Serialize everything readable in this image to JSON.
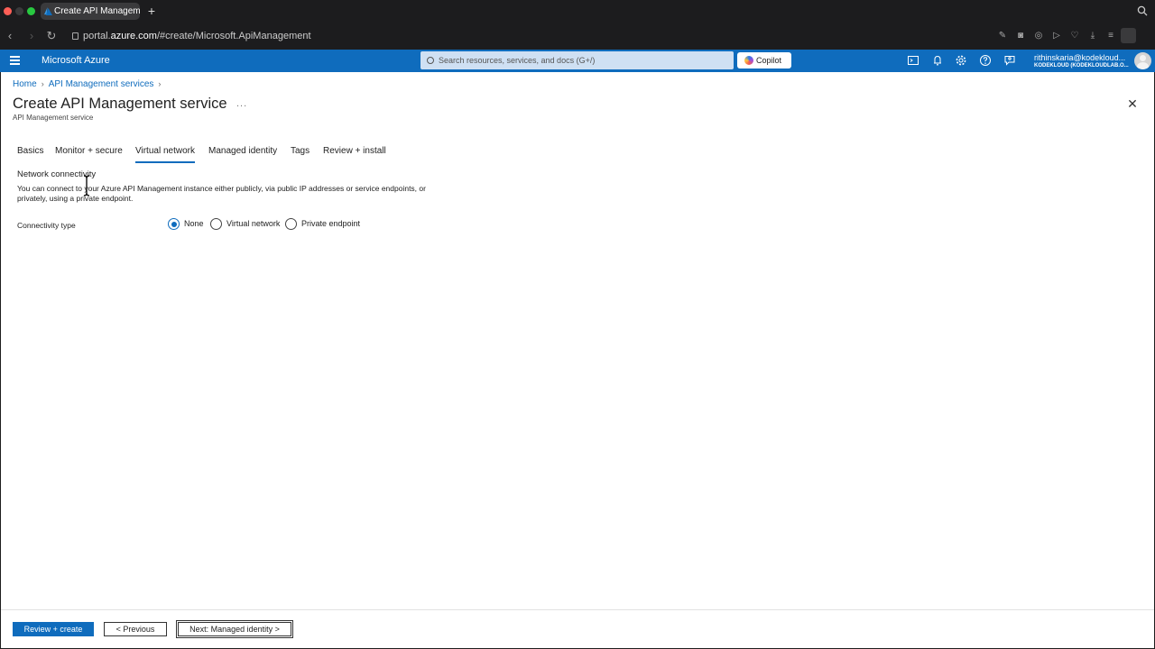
{
  "browser": {
    "tab_title": "Create API Management",
    "url_prefix": "portal.",
    "url_domain": "azure.com",
    "url_path": "/#create/Microsoft.ApiManagement"
  },
  "header": {
    "brand": "Microsoft Azure",
    "search_placeholder": "Search resources, services, and docs (G+/)",
    "copilot_label": "Copilot",
    "account_name": "rithinskaria@kodekloud...",
    "account_org": "KODEKLOUD (KODEKLOUDLAB.O..."
  },
  "breadcrumb": {
    "home": "Home",
    "parent": "API Management services"
  },
  "page": {
    "title": "Create API Management service",
    "more": "...",
    "subtitle": "API Management service"
  },
  "tabs": [
    {
      "label": "Basics"
    },
    {
      "label": "Monitor + secure"
    },
    {
      "label": "Virtual network"
    },
    {
      "label": "Managed identity"
    },
    {
      "label": "Tags"
    },
    {
      "label": "Review + install"
    }
  ],
  "active_tab": "Virtual network",
  "section": {
    "title": "Network connectivity",
    "description": "You can connect to your Azure API Management instance either publicly, via public IP addresses or service endpoints, or privately, using a private endpoint.",
    "connectivity_label": "Connectivity type",
    "options": [
      {
        "label": "None",
        "checked": true
      },
      {
        "label": "Virtual network",
        "checked": false
      },
      {
        "label": "Private endpoint",
        "checked": false
      }
    ]
  },
  "footer": {
    "review_create": "Review + create",
    "previous": "< Previous",
    "next": "Next: Managed identity >"
  },
  "colors": {
    "azure_blue": "#0f6cbd",
    "search_bg": "#cfe0f3"
  }
}
